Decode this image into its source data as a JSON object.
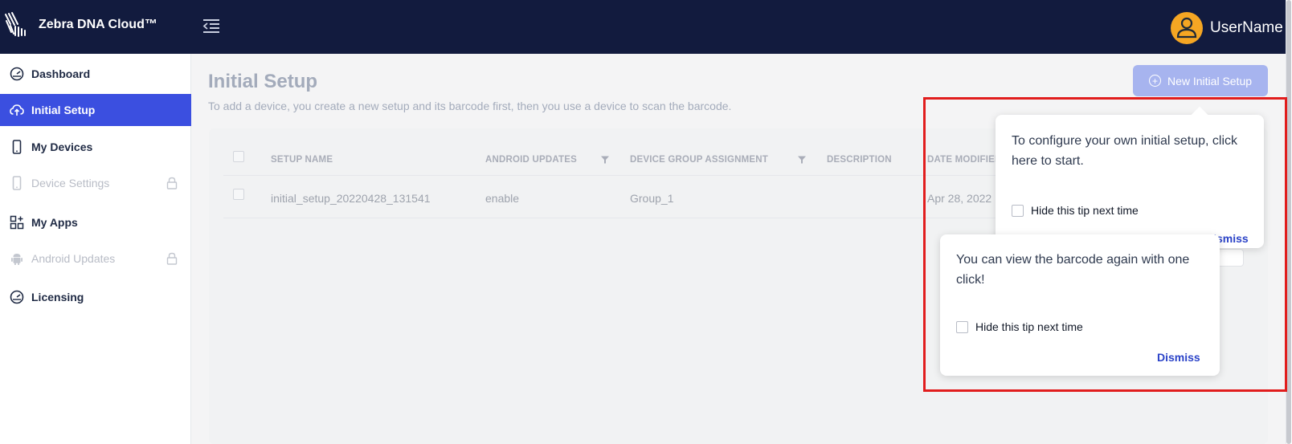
{
  "app": {
    "brand": "Zebra DNA Cloud™",
    "username": "UserName"
  },
  "sidebar": {
    "items": [
      {
        "label": "Dashboard",
        "icon": "dashboard-gauge-icon",
        "state": "normal"
      },
      {
        "label": "Initial Setup",
        "icon": "cloud-upload-icon",
        "state": "active"
      },
      {
        "label": "My Devices",
        "icon": "phone-icon",
        "state": "normal"
      },
      {
        "label": "Device Settings",
        "icon": "phone-icon",
        "state": "locked"
      },
      {
        "label": "My Apps",
        "icon": "apps-grid-icon",
        "state": "normal"
      },
      {
        "label": "Android Updates",
        "icon": "android-icon",
        "state": "locked"
      },
      {
        "label": "Licensing",
        "icon": "dashboard-gauge-icon",
        "state": "normal"
      }
    ]
  },
  "main": {
    "title": "Initial Setup",
    "subtitle": "To add a device, you create a new setup and its barcode first, then you use a device to scan the barcode.",
    "new_button_label": "New Initial Setup",
    "table": {
      "columns": [
        "SETUP NAME",
        "ANDROID UPDATES",
        "DEVICE GROUP ASSIGNMENT",
        "DESCRIPTION",
        "DATE MODIFIED"
      ],
      "rows": [
        [
          "initial_setup_20220428_131541",
          "enable",
          "Group_1",
          "",
          "Apr 28, 2022"
        ]
      ]
    }
  },
  "tips": {
    "tip1": {
      "text": "To configure your own initial setup, click here to start.",
      "checkbox_label": "Hide this tip next time",
      "dismiss_label": "Dismiss"
    },
    "tip2": {
      "text": "You can view the barcode again with one click!",
      "checkbox_label": "Hide this tip next time",
      "dismiss_label": "Dismiss"
    }
  },
  "colors": {
    "topbar": "#121b3e",
    "active_nav": "#3b4fe0",
    "primary_button": "#a7b4ef",
    "highlight_border": "#e11d1d",
    "avatar": "#f5a623",
    "link": "#2b43c8"
  }
}
